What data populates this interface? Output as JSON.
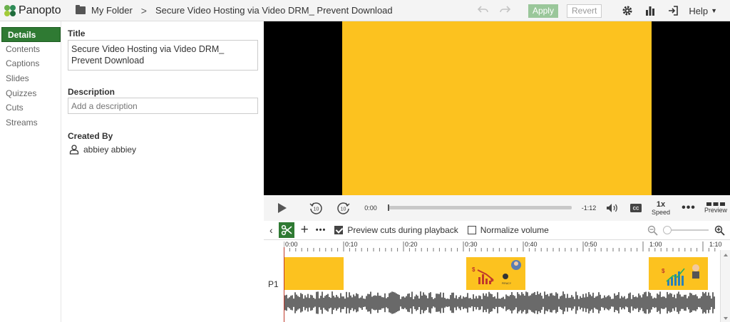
{
  "header": {
    "app_name": "Panopto",
    "breadcrumb_folder": "My Folder",
    "breadcrumb_separator": ">",
    "page_title": "Secure Video Hosting via Video DRM_ Prevent Download",
    "apply_label": "Apply",
    "revert_label": "Revert",
    "help_label": "Help",
    "icons": [
      "undo-icon",
      "redo-icon",
      "settings-icon",
      "stats-icon",
      "exit-icon"
    ]
  },
  "sidebar": {
    "items": [
      {
        "label": "Details",
        "active": true
      },
      {
        "label": "Contents"
      },
      {
        "label": "Captions"
      },
      {
        "label": "Slides"
      },
      {
        "label": "Quizzes"
      },
      {
        "label": "Cuts"
      },
      {
        "label": "Streams"
      }
    ]
  },
  "details": {
    "title_label": "Title",
    "title_value": "Secure Video Hosting via Video DRM_ Prevent Download",
    "description_label": "Description",
    "description_placeholder": "Add a description",
    "created_by_label": "Created By",
    "creator_name": "abbiey abbiey"
  },
  "player": {
    "current_time": "0:00",
    "remaining_time": "-1:12",
    "progress": 0,
    "speed_value": "1x",
    "speed_label": "Speed",
    "preview_label": "Preview",
    "rewind_seconds": "10",
    "forward_seconds": "10",
    "cc_label": "CC"
  },
  "edit_toolbar": {
    "preview_cuts_label": "Preview cuts during playback",
    "preview_cuts_checked": true,
    "normalize_label": "Normalize volume",
    "normalize_checked": false
  },
  "timeline": {
    "track_label": "P1",
    "ticks": [
      "0:00",
      "0:10",
      "0:20",
      "0:30",
      "0:40",
      "0:50",
      "1:00",
      "1:10"
    ],
    "colors": {
      "accent": "#2f7a33",
      "video_bg": "#fcc21f",
      "waveform": "#444444",
      "playhead": "#c0392b"
    }
  }
}
